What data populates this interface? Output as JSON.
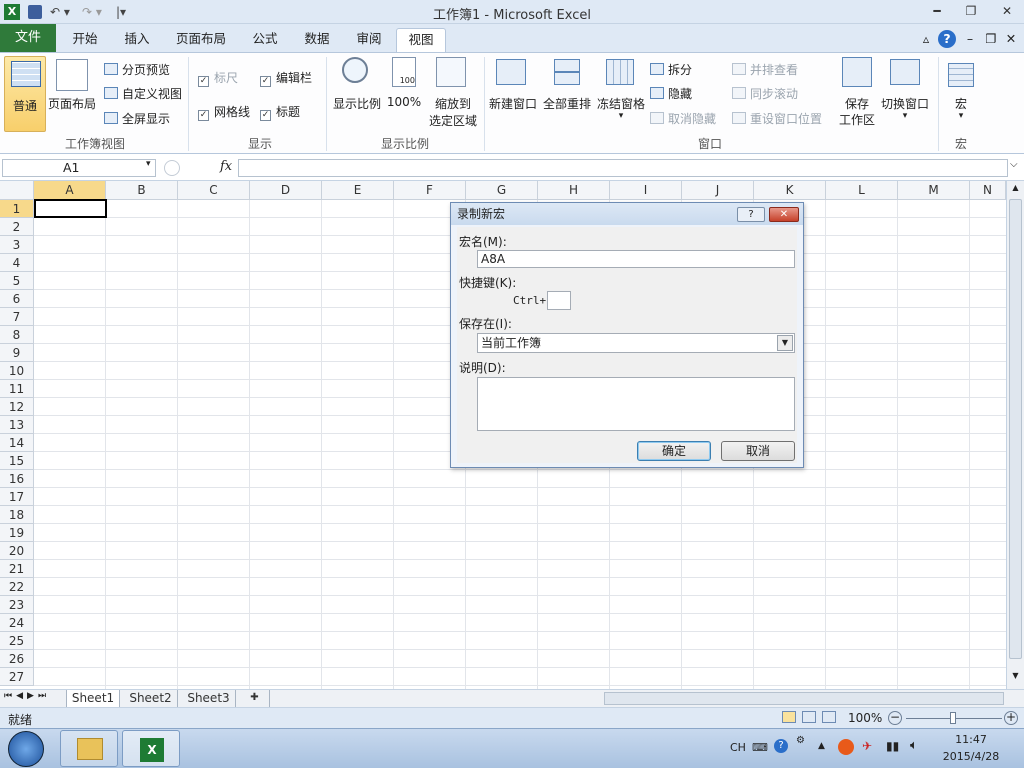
{
  "app": {
    "title": "工作簿1 - Microsoft Excel"
  },
  "quick_access": {
    "save_icon": "save-icon",
    "undo_icon": "undo-icon",
    "redo_icon": "redo-icon",
    "customize_icon": "chevron-down-icon"
  },
  "window_controls": {
    "minimize": "━",
    "restore": "❐",
    "close": "✕"
  },
  "ribbon_tabs": [
    "文件",
    "开始",
    "插入",
    "页面布局",
    "公式",
    "数据",
    "审阅",
    "视图"
  ],
  "active_tab": "视图",
  "ribbon_right_icons": {
    "collapse": "▵",
    "help": "?"
  },
  "groups": {
    "workbook_views": {
      "label": "工作簿视图",
      "normal": "普通",
      "page_layout": "页面布局",
      "page_break": "分页预览",
      "custom_views": "自定义视图",
      "full_screen": "全屏显示"
    },
    "show": {
      "label": "显示",
      "ruler": "标尺",
      "formula_bar": "编辑栏",
      "gridlines": "网格线",
      "headings": "标题",
      "ruler_checked": true,
      "formula_bar_checked": true,
      "gridlines_checked": true,
      "headings_checked": true
    },
    "zoom": {
      "label": "显示比例",
      "zoom": "显示比例",
      "hundred": "100%",
      "zoom_sel_1": "缩放到",
      "zoom_sel_2": "选定区域"
    },
    "window": {
      "label": "窗口",
      "new_window": "新建窗口",
      "arrange_all": "全部重排",
      "freeze_panes": "冻结窗格",
      "split": "拆分",
      "hide": "隐藏",
      "unhide": "取消隐藏",
      "side_by_side": "并排查看",
      "sync_scroll": "同步滚动",
      "reset_position": "重设窗口位置",
      "save_ws_1": "保存",
      "save_ws_2": "工作区",
      "switch_windows": "切换窗口"
    },
    "macros": {
      "label": "宏",
      "macros": "宏"
    }
  },
  "formula_bar": {
    "name_box": "A1",
    "fx": "fx"
  },
  "columns": [
    "A",
    "B",
    "C",
    "D",
    "E",
    "F",
    "G",
    "H",
    "I",
    "J",
    "K",
    "L",
    "M",
    "N"
  ],
  "rows": [
    "1",
    "2",
    "3",
    "4",
    "5",
    "6",
    "7",
    "8",
    "9",
    "10",
    "11",
    "12",
    "13",
    "14",
    "15",
    "16",
    "17",
    "18",
    "19",
    "20",
    "21",
    "22",
    "23",
    "24",
    "25",
    "26",
    "27"
  ],
  "active_cell": "A1",
  "sheets": [
    "Sheet1",
    "Sheet2",
    "Sheet3"
  ],
  "status": {
    "ready": "就绪",
    "zoom": "100%"
  },
  "dialog": {
    "title": "录制新宏",
    "help_btn": "?",
    "close_btn": "✕",
    "macro_name_label": "宏名(M):",
    "macro_name_value": "A8A",
    "shortcut_label": "快捷键(K):",
    "ctrl_label": "Ctrl+",
    "shortcut_value": "",
    "store_in_label": "保存在(I):",
    "store_in_value": "当前工作簿",
    "description_label": "说明(D):",
    "description_value": "",
    "ok": "确定",
    "cancel": "取消"
  },
  "taskbar": {
    "lang": "CH",
    "time": "11:47",
    "date": "2015/4/28"
  }
}
